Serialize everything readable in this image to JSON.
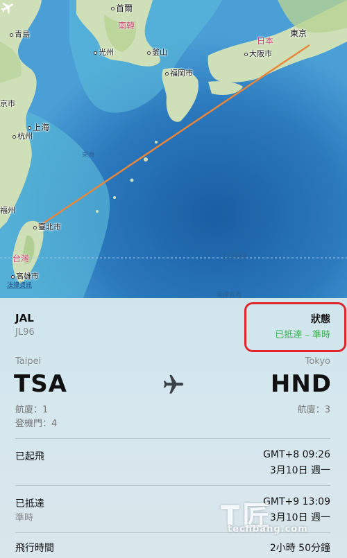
{
  "map": {
    "countries": {
      "korea": "南韓",
      "japan": "日本",
      "taiwan": "台灣"
    },
    "cities": {
      "seoul": "首爾",
      "qingdao": "青島",
      "gwangju": "光州",
      "busan": "釜山",
      "fukuoka": "福岡市",
      "osaka": "大阪市",
      "tokyo": "東京",
      "nanjing": "京市",
      "shanghai": "上海",
      "hangzhou": "杭州",
      "fuzhou": "福州",
      "taipei": "臺北市",
      "kaohsiung": "高雄市"
    },
    "seas": {
      "east_sea": "東海",
      "pacific_1": "北回歸線",
      "pacific_2": "菲律賓海"
    },
    "legal_link": "法律資訊",
    "colors": {
      "route": "#e8863a",
      "ocean": "#2f7fbf",
      "land": "#cfe0b8"
    }
  },
  "flight": {
    "airline": "JAL",
    "number": "JL96",
    "status_label": "狀態",
    "status_value": "已抵達 – 準時",
    "status_color": "#35b14d",
    "highlight_color": "#e0262c",
    "origin": {
      "city": "Taipei",
      "code": "TSA",
      "terminal": "航廈：1",
      "gate": "登機門：4"
    },
    "destination": {
      "city": "Tokyo",
      "code": "HND",
      "terminal": "航廈：3"
    },
    "departed": {
      "label": "已起飛",
      "time": "GMT+8 09:26",
      "date": "3月10日 週一"
    },
    "arrived": {
      "label": "已抵達",
      "sub": "準時",
      "time": "GMT+9 13:09",
      "date": "3月10日 週一"
    },
    "duration": {
      "label": "飛行時間",
      "value": "2小時 50分鐘"
    }
  },
  "watermark": {
    "big": "T匠",
    "small": "techbang.com"
  }
}
